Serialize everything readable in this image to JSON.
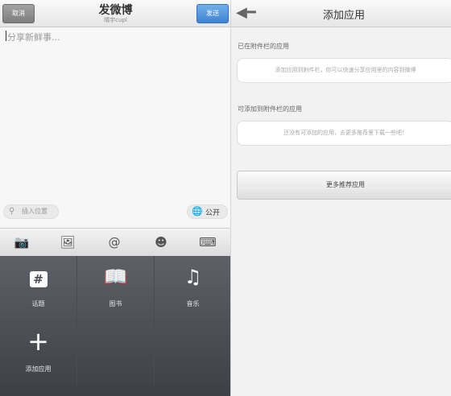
{
  "compose": {
    "cancel_label": "取消",
    "send_label": "发送",
    "title": "发微博",
    "subtitle": "晴宇cupl",
    "placeholder": "分享新鲜事...",
    "location_label": "插入位置",
    "visibility_label": "公开",
    "toolbar_icons": [
      "camera-icon",
      "image-icon",
      "at-icon",
      "emoji-icon",
      "keyboard-icon"
    ],
    "toolbar_glyphs": {
      "camera": "📷",
      "image": "🖼",
      "at": "@",
      "emoji": "☻",
      "keyboard": "⌨"
    },
    "panel_items": [
      {
        "label": "话题",
        "icon": "hashtag-icon",
        "glyph": "#"
      },
      {
        "label": "图书",
        "icon": "book-icon",
        "glyph": "📖"
      },
      {
        "label": "音乐",
        "icon": "music-icon",
        "glyph": "♫"
      },
      {
        "label": "添加应用",
        "icon": "plus-icon",
        "glyph": "+"
      }
    ]
  },
  "apps": {
    "title": "添加应用",
    "attached_section_title": "已在附件栏的应用",
    "attached_hint": "添加应用到附件栏，你可以快速分享应用里的内容到微博",
    "available_section_title": "可添加到附件栏的应用",
    "available_hint": "还没有可添加的应用，去更多推荐里下载一些吧！",
    "more_button_label": "更多推荐应用"
  },
  "colors": {
    "send_button": "#4a8fdc",
    "cancel_button": "#8e8e8e",
    "panel_bg": "#4e5058"
  }
}
